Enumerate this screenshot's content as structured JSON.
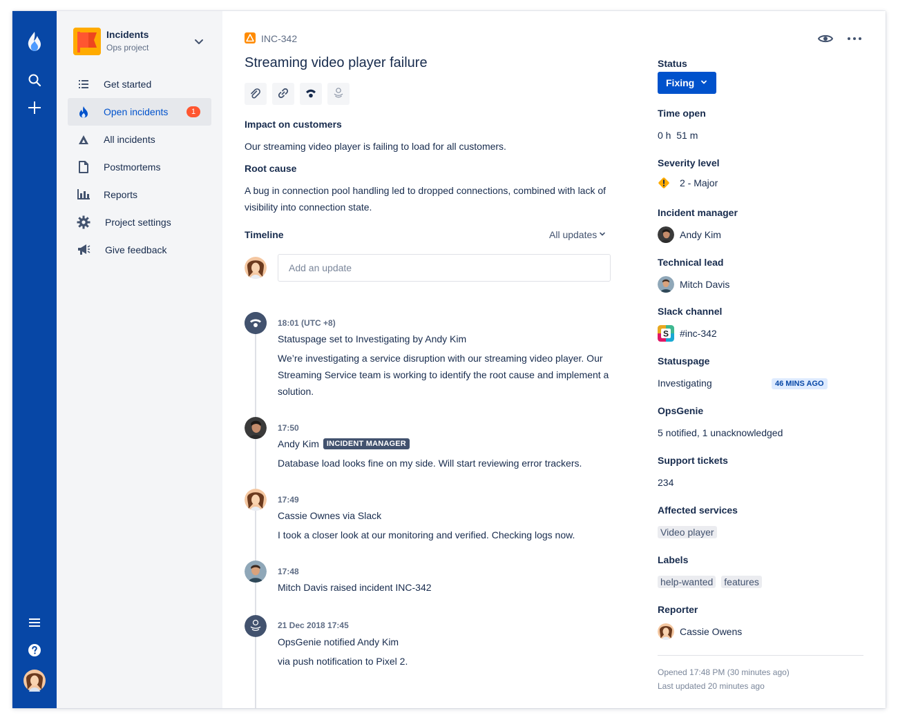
{
  "project": {
    "name": "Incidents",
    "subtitle": "Ops project"
  },
  "sidebar": {
    "items": [
      {
        "label": "Get started",
        "icon": "list-icon"
      },
      {
        "label": "Open incidents",
        "icon": "flame-icon",
        "badge": "1",
        "active": true
      },
      {
        "label": "All incidents",
        "icon": "warning-triangle-icon"
      },
      {
        "label": "Postmortems",
        "icon": "document-icon"
      },
      {
        "label": "Reports",
        "icon": "bar-chart-icon"
      },
      {
        "label": "Project settings",
        "icon": "gear-icon"
      },
      {
        "label": "Give feedback",
        "icon": "megaphone-icon"
      }
    ]
  },
  "issue": {
    "key": "INC-342",
    "title": "Streaming video player failure",
    "impact_heading": "Impact on customers",
    "impact_text": "Our streaming video player is failing to load for all customers.",
    "root_heading": "Root cause",
    "root_text": "A bug in connection pool handling led to dropped connections, combined with lack of visibility into connection state."
  },
  "timeline": {
    "heading": "Timeline",
    "filter": "All updates",
    "composer_placeholder": "Add an update",
    "entries": [
      {
        "time": "18:01 (UTC +8)",
        "title": "Statuspage set to Investigating by Andy Kim",
        "body": "We’re investigating a service disruption with our streaming video player. Our Streaming Service team is working to identify the root cause and implement a solution.",
        "avatar": "statuspage-icon"
      },
      {
        "time": "17:50",
        "title": "Andy Kim",
        "lozenge": "INCIDENT MANAGER",
        "body": "Database load looks fine on my side. Will start reviewing error trackers.",
        "avatar": "andy-kim-avatar"
      },
      {
        "time": "17:49",
        "title": "Cassie Ownes via Slack",
        "body": "I took a closer look at our monitoring and verified. Checking logs now.",
        "avatar": "cassie-owens-avatar"
      },
      {
        "time": "17:48",
        "title": "Mitch Davis raised incident INC-342",
        "body": "",
        "avatar": "mitch-davis-avatar"
      },
      {
        "time": "21 Dec 2018 17:45",
        "title": "OpsGenie notified Andy Kim",
        "body": "via push notification to Pixel 2.",
        "avatar": "opsgenie-icon"
      }
    ]
  },
  "details": {
    "status_label": "Status",
    "status_value": "Fixing",
    "time_open_label": "Time open",
    "time_open_value": "0 h  51 m",
    "severity_label": "Severity level",
    "severity_value": "2 - Major",
    "manager_label": "Incident manager",
    "manager_value": "Andy Kim",
    "tech_lead_label": "Technical lead",
    "tech_lead_value": "Mitch Davis",
    "slack_label": "Slack channel",
    "slack_value": "#inc-342",
    "statuspage_label": "Statuspage",
    "statuspage_value": "Investigating",
    "statuspage_badge": "46 MINS AGO",
    "opsgenie_label": "OpsGenie",
    "opsgenie_value": "5 notified, 1 unacknowledged",
    "support_label": "Support tickets",
    "support_value": "234",
    "affected_label": "Affected services",
    "affected_services": [
      "Video player"
    ],
    "labels_label": "Labels",
    "labels": [
      "help-wanted",
      "features"
    ],
    "reporter_label": "Reporter",
    "reporter_value": "Cassie Owens",
    "opened": "Opened 17:48 PM (30 minutes ago)",
    "updated": "Last updated 20 minutes ago"
  },
  "colors": {
    "global_nav": "#0747A6",
    "primary": "#0052CC",
    "badge": "#FF5630",
    "warning": "#FFAB00"
  }
}
